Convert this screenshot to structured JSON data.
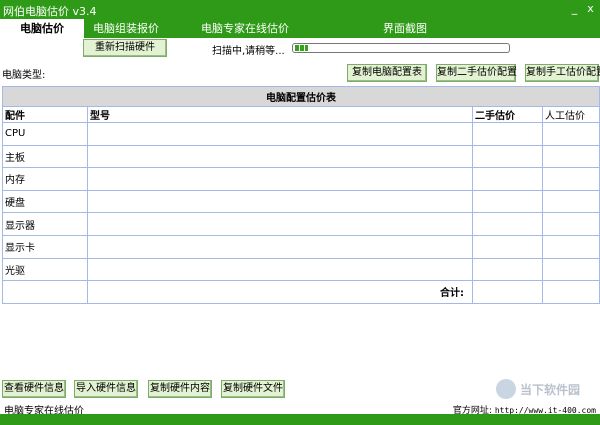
{
  "window": {
    "title": "网伯电脑估价 v3.4",
    "minimize": "_",
    "close": "x"
  },
  "tabs": [
    {
      "label": "电脑估价",
      "active": true
    },
    {
      "label": "电脑组装报价",
      "active": false
    },
    {
      "label": "电脑专家在线估价",
      "active": false
    },
    {
      "label": "界面截图",
      "active": false
    }
  ],
  "toolbar": {
    "rescan_label": "重新扫描硬件",
    "scan_status": "扫描中,请稍等...",
    "progress": 0.06
  },
  "config": {
    "type_label": "电脑类型:",
    "copy_config_label": "复制电脑配置表",
    "copy_used_label": "复制二手估价配置",
    "copy_manual_label": "复制手工估价配置"
  },
  "table": {
    "caption": "电脑配置估价表",
    "headers": {
      "part": "配件",
      "model": "型号",
      "used_price": "二手估价",
      "manual_price": "人工估价"
    },
    "rows": [
      {
        "part": "CPU",
        "model": "",
        "used_price": "",
        "manual_price": ""
      },
      {
        "part": "主板",
        "model": "",
        "used_price": "",
        "manual_price": ""
      },
      {
        "part": "内存",
        "model": "",
        "used_price": "",
        "manual_price": ""
      },
      {
        "part": "硬盘",
        "model": "",
        "used_price": "",
        "manual_price": ""
      },
      {
        "part": "显示器",
        "model": "",
        "used_price": "",
        "manual_price": ""
      },
      {
        "part": "显示卡",
        "model": "",
        "used_price": "",
        "manual_price": ""
      },
      {
        "part": "光驱",
        "model": "",
        "used_price": "",
        "manual_price": ""
      }
    ],
    "total_label": "合计:"
  },
  "bottom": {
    "view_hw_label": "查看硬件信息",
    "import_hw_label": "导入硬件信息",
    "copy_hw_content_label": "复制硬件内容",
    "copy_hw_file_label": "复制硬件文件",
    "expert_link": "电脑专家在线估价",
    "website_label": "官方网址:",
    "website_url": "http://www.it-400.com"
  },
  "watermark": {
    "text": "当下软件园"
  },
  "colors": {
    "brand_green": "#2f9a17",
    "button_bg": "#e2f2d2",
    "grid_line": "#a5b9e6",
    "caption_bg": "#d8d8d8"
  }
}
